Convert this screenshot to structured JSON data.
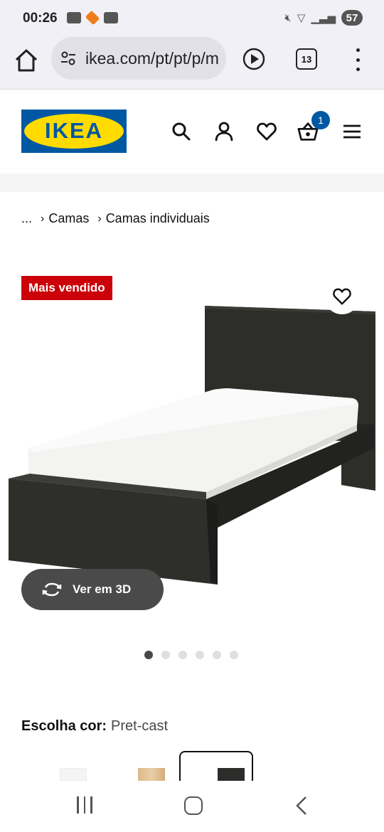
{
  "status_bar": {
    "time": "00:26",
    "battery": "57"
  },
  "browser": {
    "url": "ikea.com/pt/pt/p/m",
    "tab_count": "13",
    "icons": [
      "home-icon",
      "site-settings-icon",
      "play-icon",
      "tabs-icon",
      "more-icon"
    ]
  },
  "header": {
    "logo_text": "IKEA",
    "cart_count": "1",
    "icons": [
      "search-icon",
      "account-icon",
      "heart-icon",
      "basket-icon",
      "hamburger-icon"
    ],
    "brand_colors": {
      "blue": "#0058a3",
      "yellow": "#ffdb00"
    }
  },
  "breadcrumb": {
    "ellipsis": "...",
    "items": [
      "Camas",
      "Camas individuais"
    ]
  },
  "product": {
    "badge": "Mais vendido",
    "badge_color": "#cc0008",
    "view_3d_label": "Ver em 3D",
    "image_count": 6,
    "active_image": 1
  },
  "color_selector": {
    "label": "Escolha cor:",
    "value": "Pret-cast",
    "swatches": [
      "branco",
      "carvalho",
      "preto-castanho"
    ],
    "selected_swatch": 3
  },
  "nav_bar": {
    "icons": [
      "recent-apps-icon",
      "home-circle-icon",
      "back-icon"
    ]
  }
}
